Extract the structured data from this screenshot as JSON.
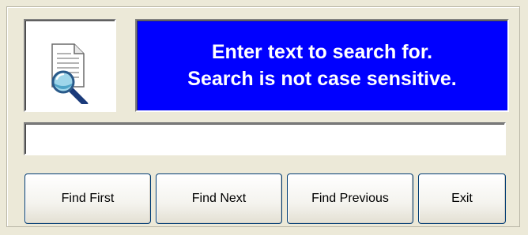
{
  "dialog": {
    "icon": "document-search-icon",
    "message_line1": "Enter text to search for.",
    "message_line2": "Search is not case sensitive.",
    "message_bg_color": "#0000ff",
    "message_text_color": "#ffffff"
  },
  "search": {
    "value": "",
    "placeholder": ""
  },
  "buttons": {
    "find_first": "Find First",
    "find_next": "Find Next",
    "find_previous": "Find Previous",
    "exit": "Exit"
  }
}
